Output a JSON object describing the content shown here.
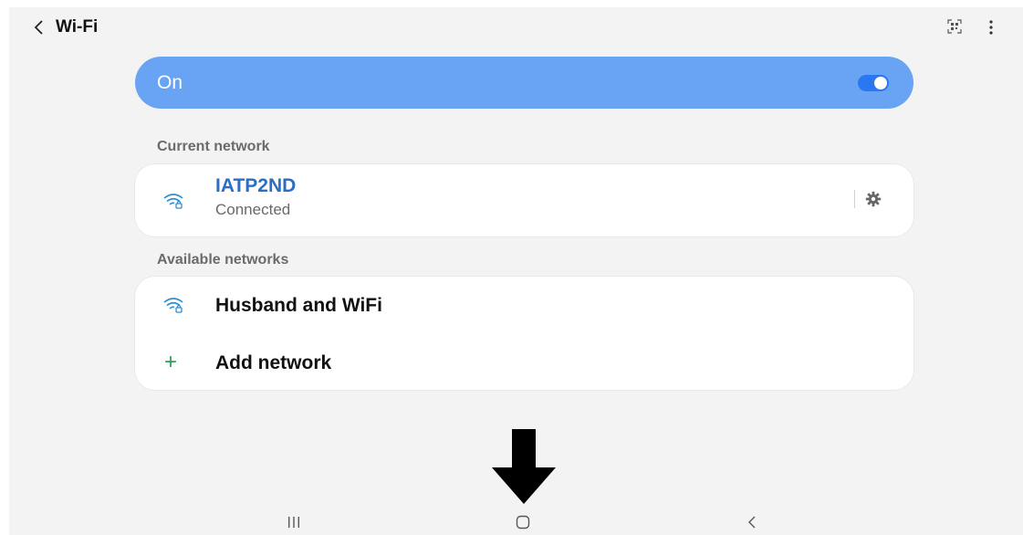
{
  "header": {
    "title": "Wi-Fi",
    "back_icon": "chevron-left-icon",
    "qr_icon": "qr-scan-icon",
    "more_icon": "more-vertical-icon"
  },
  "master_toggle": {
    "label": "On",
    "state": "on",
    "banner_color": "#69a3f4"
  },
  "current_network": {
    "section_label": "Current network",
    "name": "IATP2ND",
    "status": "Connected",
    "icon": "wifi-locked-icon",
    "settings_icon": "gear-icon"
  },
  "available_networks": {
    "section_label": "Available networks",
    "items": [
      {
        "name": "Husband and WiFi",
        "icon": "wifi-locked-icon"
      }
    ],
    "add_network_label": "Add network",
    "add_icon": "plus-icon"
  },
  "navbar": {
    "recents_icon": "recents-icon",
    "home_icon": "home-icon",
    "back_icon": "back-icon"
  },
  "annotation": {
    "icon": "down-arrow-icon"
  },
  "colors": {
    "accent": "#2b6fc2",
    "switch_track": "#2a78f0",
    "add_green": "#2e9d57"
  }
}
